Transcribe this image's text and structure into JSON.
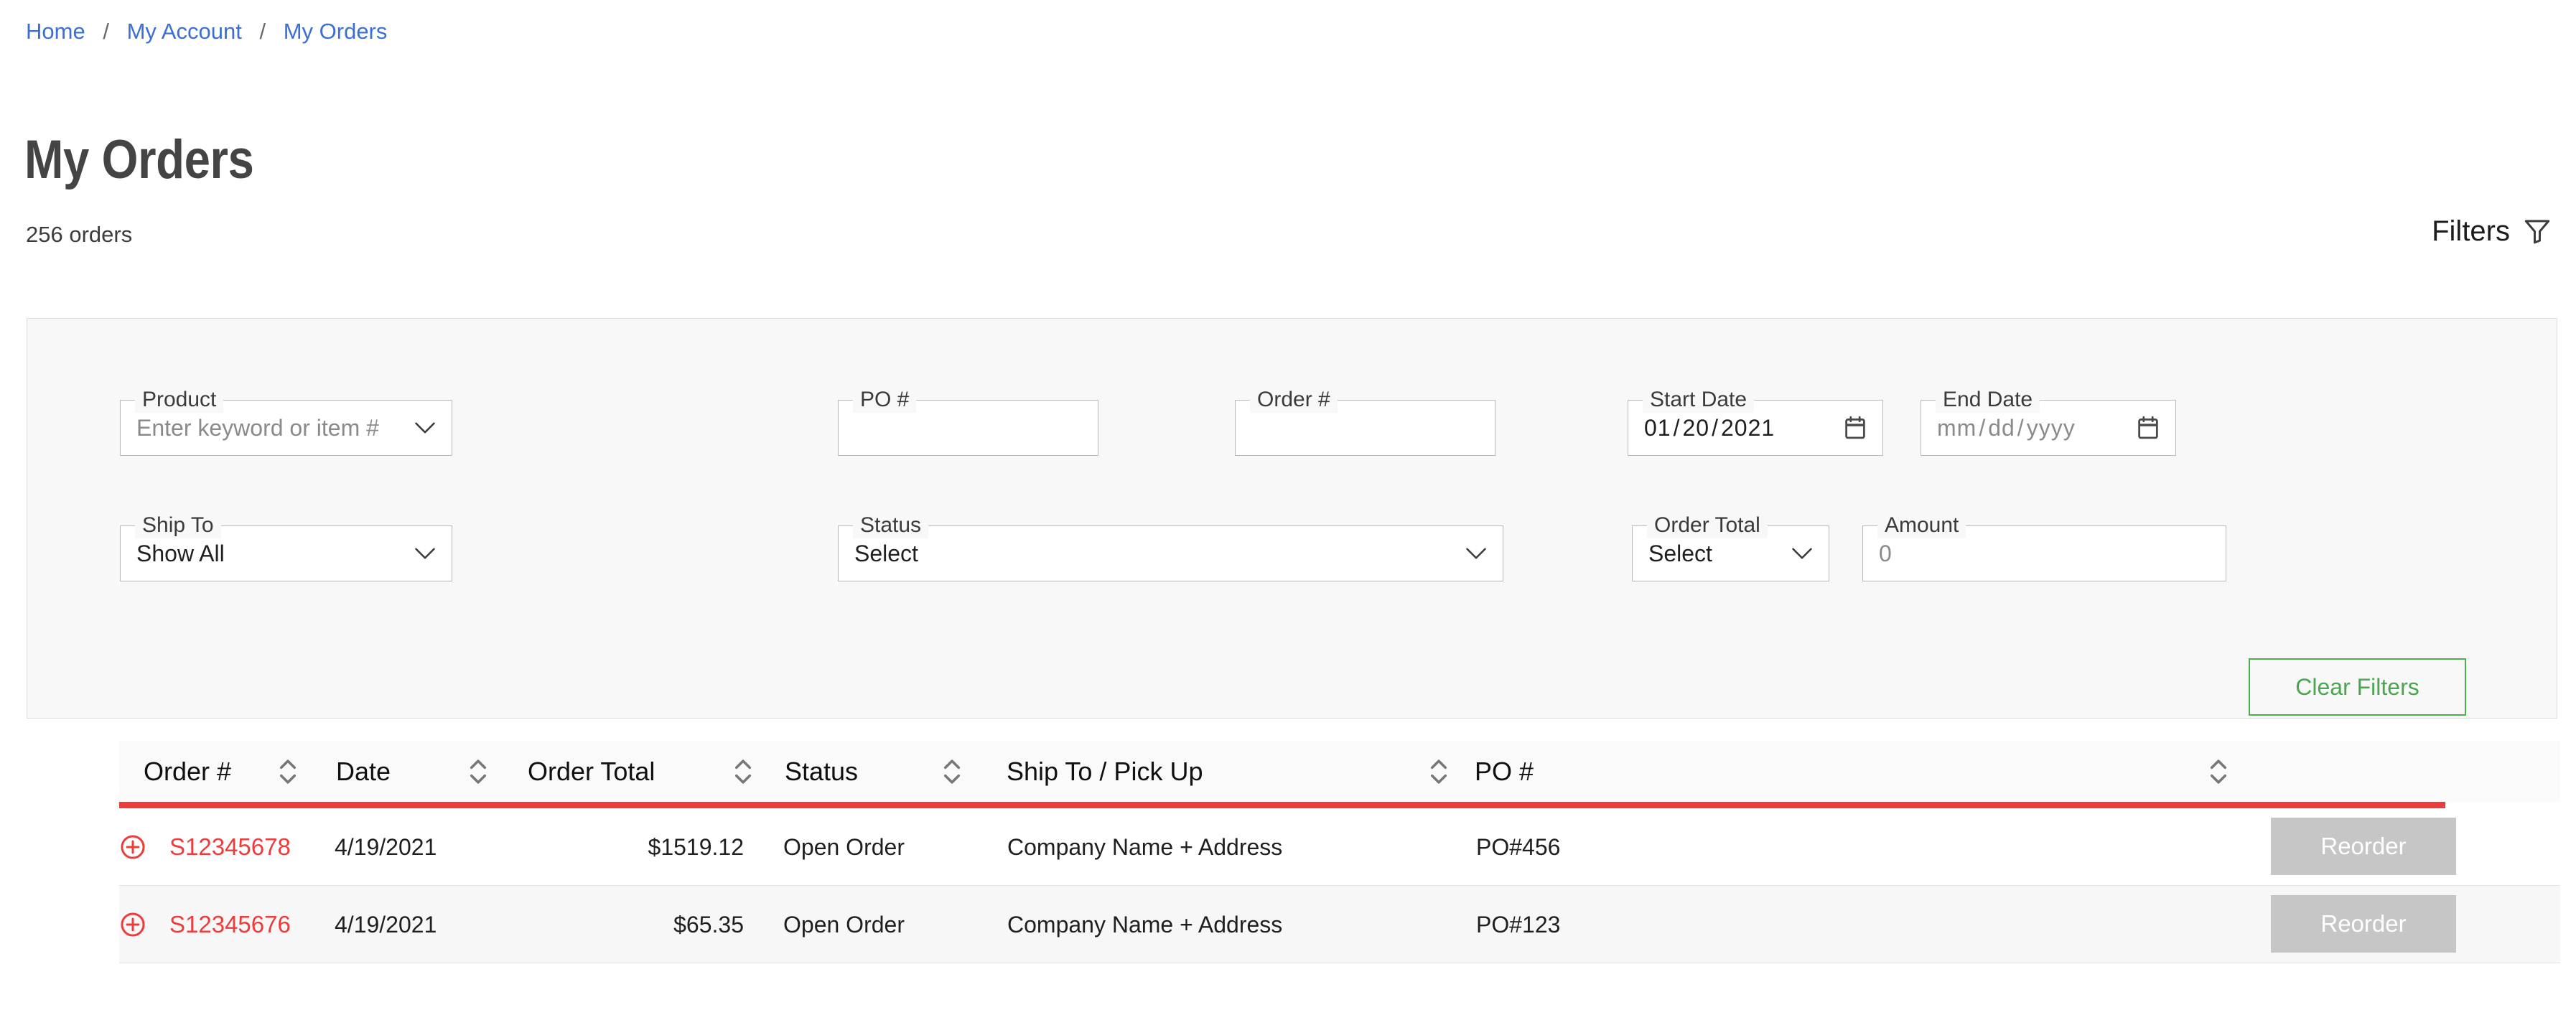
{
  "breadcrumb": {
    "items": [
      {
        "label": "Home",
        "current": false
      },
      {
        "label": "My Account",
        "current": false
      },
      {
        "label": "My Orders",
        "current": true
      }
    ],
    "separator": "/"
  },
  "page": {
    "title": "My Orders",
    "orders_count_text": "256 orders"
  },
  "filters_toggle": {
    "label": "Filters",
    "icon": "funnel-icon"
  },
  "filters": {
    "product": {
      "label": "Product",
      "placeholder": "Enter keyword or item #",
      "value": "",
      "icon": "chevron-down-icon"
    },
    "po_number": {
      "label": "PO #",
      "value": "",
      "placeholder": ""
    },
    "order_number": {
      "label": "Order #",
      "value": "",
      "placeholder": ""
    },
    "start_date": {
      "label": "Start Date",
      "value": "01/20/2021",
      "month": "01",
      "day": "20",
      "year": "2021",
      "separator": "/",
      "icon": "calendar-icon"
    },
    "end_date": {
      "label": "End Date",
      "placeholder": "mm/dd/yyyy",
      "value": "",
      "month": "mm",
      "day": "dd",
      "year": "yyyy",
      "separator": "/",
      "icon": "calendar-icon"
    },
    "ship_to": {
      "label": "Ship To",
      "value": "Show All",
      "icon": "chevron-down-icon"
    },
    "status": {
      "label": "Status",
      "value": "Select",
      "icon": "chevron-down-icon"
    },
    "order_total": {
      "label": "Order Total",
      "value": "Select",
      "icon": "chevron-down-icon"
    },
    "amount": {
      "label": "Amount",
      "placeholder": "0",
      "value": ""
    },
    "clear_button": {
      "label": "Clear Filters",
      "border_color": "#4caf50",
      "text_color": "#4aa64f"
    }
  },
  "table": {
    "accent_color": "#ee3b3b",
    "columns": [
      {
        "key": "order_number",
        "label": "Order #",
        "sortable": true
      },
      {
        "key": "date",
        "label": "Date",
        "sortable": true
      },
      {
        "key": "order_total",
        "label": "Order Total",
        "sortable": true
      },
      {
        "key": "status",
        "label": "Status",
        "sortable": true
      },
      {
        "key": "ship_to",
        "label": "Ship To / Pick Up",
        "sortable": true
      },
      {
        "key": "po_number",
        "label": "PO #",
        "sortable": true
      }
    ],
    "rows": [
      {
        "expand_icon": "plus-circle-icon",
        "order_number": "S12345678",
        "date": "4/19/2021",
        "order_total": "$1519.12",
        "status": "Open Order",
        "ship_to": "Company Name + Address",
        "po_number": "PO#456",
        "action_label": "Reorder"
      },
      {
        "expand_icon": "plus-circle-icon",
        "order_number": "S12345676",
        "date": "4/19/2021",
        "order_total": "$65.35",
        "status": "Open Order",
        "ship_to": "Company Name + Address",
        "po_number": "PO#123",
        "action_label": "Reorder"
      }
    ]
  }
}
